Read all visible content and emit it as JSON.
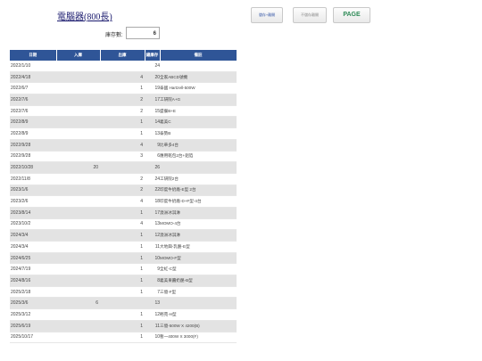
{
  "header": {
    "title": "電腦器(800長)",
    "buttons": [
      "儲存+離開",
      "不儲存離開",
      "PAGE"
    ]
  },
  "stock": {
    "label": "庫存數:",
    "value": "6"
  },
  "table": {
    "columns": [
      "日期",
      "入庫",
      "出庫",
      "總庫存",
      "備註"
    ],
    "rows": [
      {
        "date": "2022/1/10",
        "in": "",
        "out": "",
        "stock": "24",
        "note": ""
      },
      {
        "date": "2022/4/18",
        "in": "",
        "out": "4",
        "stock": "20",
        "note": "全家ABCD號機"
      },
      {
        "date": "2022/6/7",
        "in": "",
        "out": "1",
        "stock": "19",
        "note": "泰國 Hartzell-500W"
      },
      {
        "date": "2022/7/6",
        "in": "",
        "out": "2",
        "stock": "17",
        "note": "工研院A+G"
      },
      {
        "date": "2022/7/6",
        "in": "",
        "out": "2",
        "stock": "15",
        "note": "盛餐B+E"
      },
      {
        "date": "2022/8/9",
        "in": "",
        "out": "1",
        "stock": "14",
        "note": "義美C"
      },
      {
        "date": "2022/8/9",
        "in": "",
        "out": "1",
        "stock": "13",
        "note": "泰勢B"
      },
      {
        "date": "2022/9/28",
        "in": "",
        "out": "4",
        "stock": "9",
        "note": "比華多4台"
      },
      {
        "date": "2022/9/28",
        "in": "",
        "out": "3",
        "stock": "6",
        "note": "應用乾包2台+鋁箔"
      },
      {
        "date": "2022/10/28",
        "in": "20",
        "out": "",
        "stock": "26",
        "note": ""
      },
      {
        "date": "2022/11/8",
        "in": "",
        "out": "2",
        "stock": "24",
        "note": "工研院2台"
      },
      {
        "date": "2023/1/6",
        "in": "",
        "out": "2",
        "stock": "22",
        "note": "印度牛奶廠-E型 2台"
      },
      {
        "date": "2023/2/6",
        "in": "",
        "out": "4",
        "stock": "18",
        "note": "印度牛奶廠-D+F型-4台"
      },
      {
        "date": "2023/8/14",
        "in": "",
        "out": "1",
        "stock": "17",
        "note": "澳洲冰淇淋"
      },
      {
        "date": "2023/10/2",
        "in": "",
        "out": "4",
        "stock": "13",
        "note": "MOMO-4台"
      },
      {
        "date": "2024/3/4",
        "in": "",
        "out": "1",
        "stock": "12",
        "note": "澳洲冰淇淋"
      },
      {
        "date": "2024/3/4",
        "in": "",
        "out": "1",
        "stock": "11",
        "note": "大地興-乳酪-E型"
      },
      {
        "date": "2024/6/25",
        "in": "",
        "out": "1",
        "stock": "10",
        "note": "MOMO-F型"
      },
      {
        "date": "2024/7/19",
        "in": "",
        "out": "1",
        "stock": "9",
        "note": "全虹-C型"
      },
      {
        "date": "2024/8/16",
        "in": "",
        "out": "1",
        "stock": "8",
        "note": "義美果醬奶酪-B型"
      },
      {
        "date": "2025/2/18",
        "in": "",
        "out": "1",
        "stock": "7",
        "note": "三億-F型"
      },
      {
        "date": "2025/3/6",
        "in": "6",
        "out": "",
        "stock": "13",
        "note": ""
      },
      {
        "date": "2025/3/12",
        "in": "",
        "out": "1",
        "stock": "12",
        "note": "輕苑-H型"
      },
      {
        "date": "2025/6/19",
        "in": "",
        "out": "1",
        "stock": "11",
        "note": "三億-500W X 4200(B)"
      },
      {
        "date": "2025/10/17",
        "in": "",
        "out": "1",
        "stock": "10",
        "note": "暫一400W X 3000(F)"
      }
    ]
  }
}
